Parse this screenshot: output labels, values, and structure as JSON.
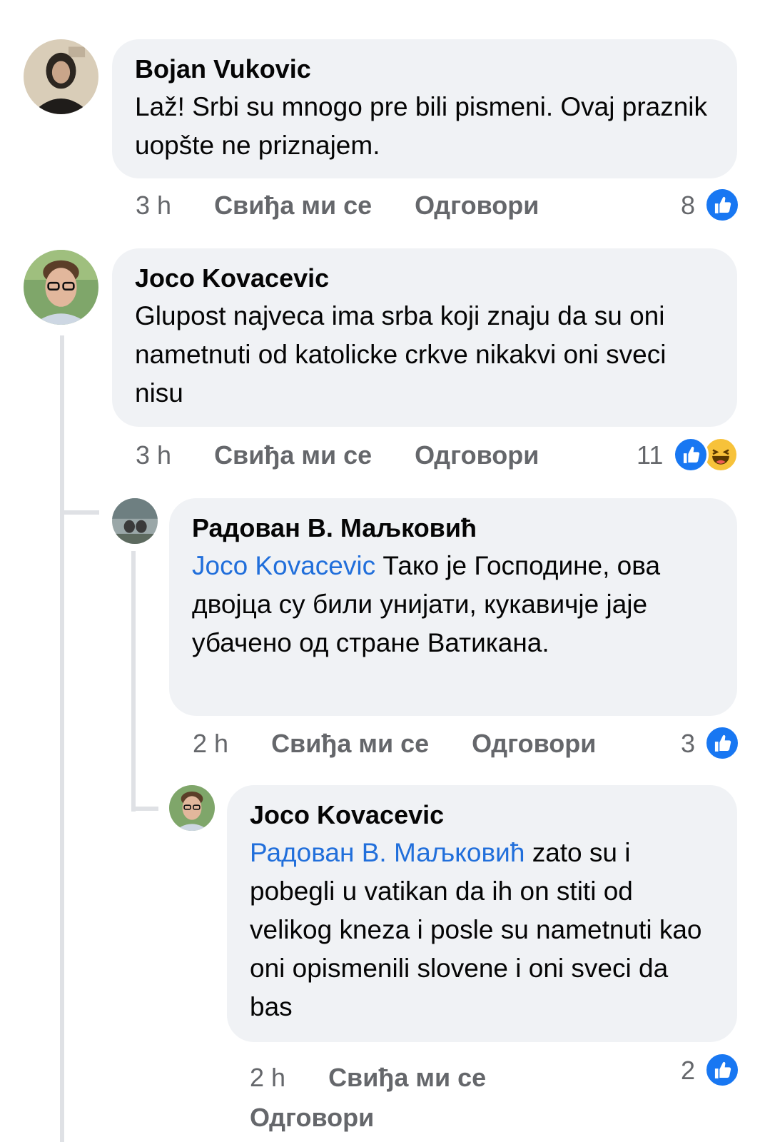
{
  "actions": {
    "like_label": "Свиђа ми се",
    "reply_label": "Одговори"
  },
  "comments": [
    {
      "author": "Bojan Vukovic",
      "text": "Laž! Srbi su mnogo pre bili pismeni. Ovaj praznik uopšte ne priznajem.",
      "time": "3 h",
      "reaction_count": "8",
      "reactions": [
        "like-icon"
      ]
    },
    {
      "author": "Joco Kovacevic",
      "text": "Glupost najveca ima srba koji znaju da su oni nametnuti od katolicke crkve nikakvi oni sveci nisu",
      "time": "3 h",
      "reaction_count": "11",
      "reactions": [
        "like-icon",
        "haha-icon"
      ]
    },
    {
      "author": "Радован В. Маљковић",
      "mention": "Joco Kovacevic",
      "text": "Тако је Господине, ова двојца су били унијати, кукавичје јаје убачено од стране Ватикана.",
      "time": "2 h",
      "reaction_count": "3",
      "reactions": [
        "like-icon"
      ]
    },
    {
      "author": "Joco Kovacevic",
      "mention": "Радован В. Маљковић",
      "text": "zato su i pobegli u vatikan da ih on stiti od velikog kneza i posle su nametnuti kao oni opismenili slovene i oni sveci da bas",
      "time": "2 h",
      "reaction_count": "2",
      "reactions": [
        "like-icon"
      ]
    }
  ],
  "colors": {
    "bubble": "#f0f2f5",
    "mention": "#216fdb",
    "like": "#1877f2",
    "meta": "#65676b"
  }
}
